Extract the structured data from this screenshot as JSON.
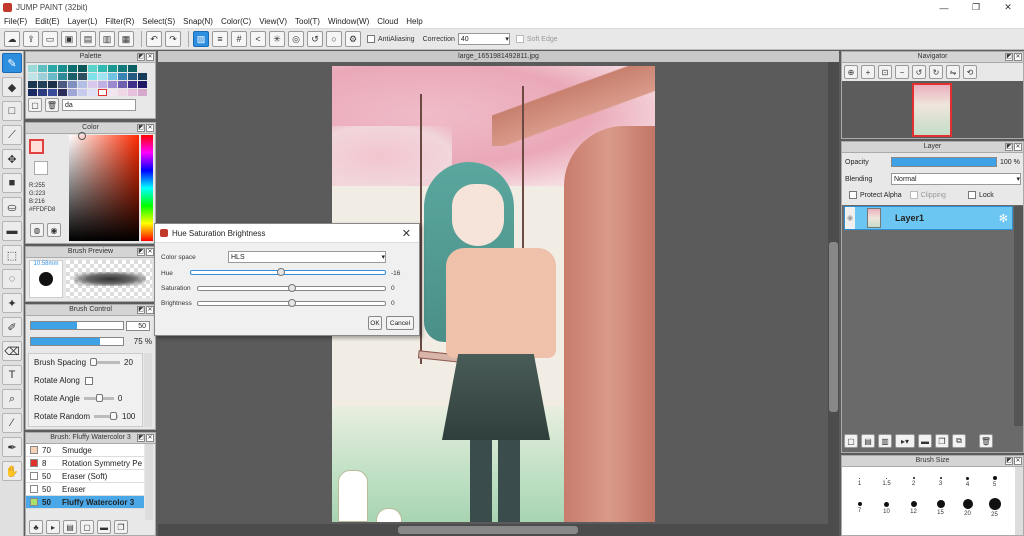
{
  "window": {
    "title": "JUMP PAINT (32bit)",
    "minimize": "—",
    "maximize": "❐",
    "close": "✕"
  },
  "menu": [
    "File(F)",
    "Edit(E)",
    "Layer(L)",
    "Filter(R)",
    "Select(S)",
    "Snap(N)",
    "Color(C)",
    "View(V)",
    "Tool(T)",
    "Window(W)",
    "Cloud",
    "Help"
  ],
  "toolbar": {
    "antialiasing_label": "AntiAliasing",
    "correction_label": "Correction",
    "correction_value": "40",
    "soft_edge_label": "Soft Edge"
  },
  "document": {
    "tab_title": "large_1651981492811.jpg"
  },
  "palette": {
    "title": "Palette",
    "add_label": "da"
  },
  "color": {
    "title": "Color",
    "r": "R:255",
    "g": "G:223",
    "b": "B:216",
    "hex": "#FFDFD8",
    "current_color": "#ffdfd8"
  },
  "brush_preview": {
    "title": "Brush Preview",
    "size": "10.58mm"
  },
  "brush_control": {
    "title": "Brush Control",
    "size_value": "50",
    "size_fraction": 0.5,
    "opacity_value": "75 %",
    "opacity_fraction": 0.75,
    "spacing_label": "Brush Spacing",
    "spacing_value": "20",
    "rotate_along_label": "Rotate Along",
    "rotate_angle_label": "Rotate Angle",
    "rotate_angle_value": "0",
    "rotate_random_label": "Rotate Random",
    "rotate_random_value": "100"
  },
  "brush_list": {
    "title": "Brush: Fluffy Watercolor 3",
    "items": [
      {
        "num": "70",
        "name": "Smudge",
        "color": "#f6d1b4"
      },
      {
        "num": "8",
        "name": "Rotation Symmetry Pe",
        "color": "#e0322a"
      },
      {
        "num": "50",
        "name": "Eraser (Soft)",
        "color": "#ffffff"
      },
      {
        "num": "50",
        "name": "Eraser",
        "color": "#ffffff"
      },
      {
        "num": "50",
        "name": "Fluffy Watercolor 3",
        "color": "#a8e06a"
      }
    ]
  },
  "dialog": {
    "title": "Hue Saturation Brightness",
    "color_space_label": "Color space",
    "color_space_value": "HLS",
    "hue_label": "Hue",
    "hue_value": "-16",
    "saturation_label": "Saturation",
    "saturation_value": "0",
    "brightness_label": "Brightness",
    "brightness_value": "0",
    "ok": "OK",
    "cancel": "Cancel"
  },
  "navigator": {
    "title": "Navigator"
  },
  "layer": {
    "title": "Layer",
    "opacity_label": "Opacity",
    "opacity_value": "100 %",
    "blending_label": "Blending",
    "blending_value": "Normal",
    "protect_alpha": "Protect Alpha",
    "clipping": "Clipping",
    "lock": "Lock",
    "layer_name": "Layer1"
  },
  "brush_size": {
    "title": "Brush Size",
    "sizes": [
      "1",
      "1.5",
      "2",
      "3",
      "4",
      "5",
      "7",
      "10",
      "12",
      "15",
      "20",
      "25"
    ]
  },
  "colors": {
    "accent": "#2e8fe0",
    "selection": "#4aa8e8"
  }
}
